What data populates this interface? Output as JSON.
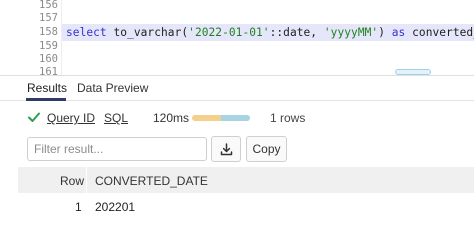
{
  "editor": {
    "line_numbers": [
      "156",
      "157",
      "158",
      "159",
      "160",
      "161"
    ],
    "code": {
      "kw_select": "select",
      "fn": " to_varchar(",
      "str1": "'2022-01-01'",
      "cast": "::date, ",
      "str2": "'yyyyMM'",
      "close": ") ",
      "kw_as": "as",
      "alias": " converted_date;"
    }
  },
  "tabs": {
    "results": "Results",
    "data_preview": "Data Preview"
  },
  "status": {
    "query_id": "Query ID",
    "sql": "SQL",
    "duration": "120ms",
    "rows": "1 rows",
    "timing_fractions": [
      0.5,
      0.5
    ]
  },
  "filter": {
    "placeholder": "Filter result...",
    "copy_label": "Copy"
  },
  "table": {
    "columns": [
      "Row",
      "CONVERTED_DATE"
    ],
    "rows": [
      {
        "row": "1",
        "converted_date": "202201"
      }
    ]
  },
  "colors": {
    "accent": "#2f3c6a",
    "success": "#2e9e56",
    "timing_compile": "#f4d08c",
    "timing_exec": "#a7d4e2",
    "highlight": "#e6e6fa"
  }
}
